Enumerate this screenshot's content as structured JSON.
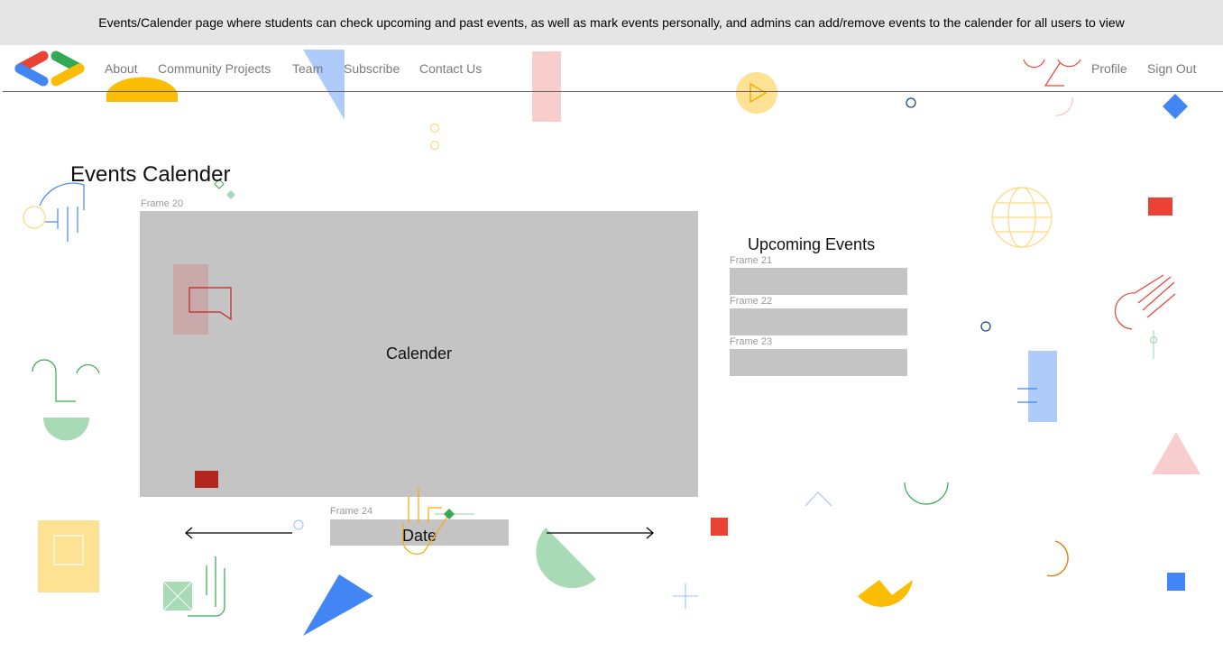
{
  "banner": {
    "text": "Events/Calender page where students can check upcoming and past events, as well as mark events personally, and admins can add/remove events to the calender for all users to view"
  },
  "nav": {
    "logo_icon": "code-brackets-logo-icon",
    "links": [
      "About",
      "Community Projects",
      "Team",
      "Subscribe",
      "Contact Us"
    ],
    "right_links": [
      "Profile",
      "Sign Out"
    ]
  },
  "page": {
    "title": "Events Calender",
    "calendar_frame_label": "Frame 20",
    "calendar_label": "Calender",
    "upcoming_title": "Upcoming Events",
    "event_frames": [
      "Frame 21",
      "Frame 22",
      "Frame 23"
    ],
    "date_frame_label": "Frame 24",
    "date_label": "Date",
    "prev_icon": "arrow-left-icon",
    "next_icon": "arrow-right-icon"
  },
  "colors": {
    "banner_bg": "#e5e5e5",
    "placeholder_gray": "#c4c4c4",
    "nav_text": "#7a7a7a",
    "google_blue": "#4285f4",
    "google_red": "#ea4335",
    "google_yellow": "#fbbc04",
    "google_green": "#34a853"
  }
}
